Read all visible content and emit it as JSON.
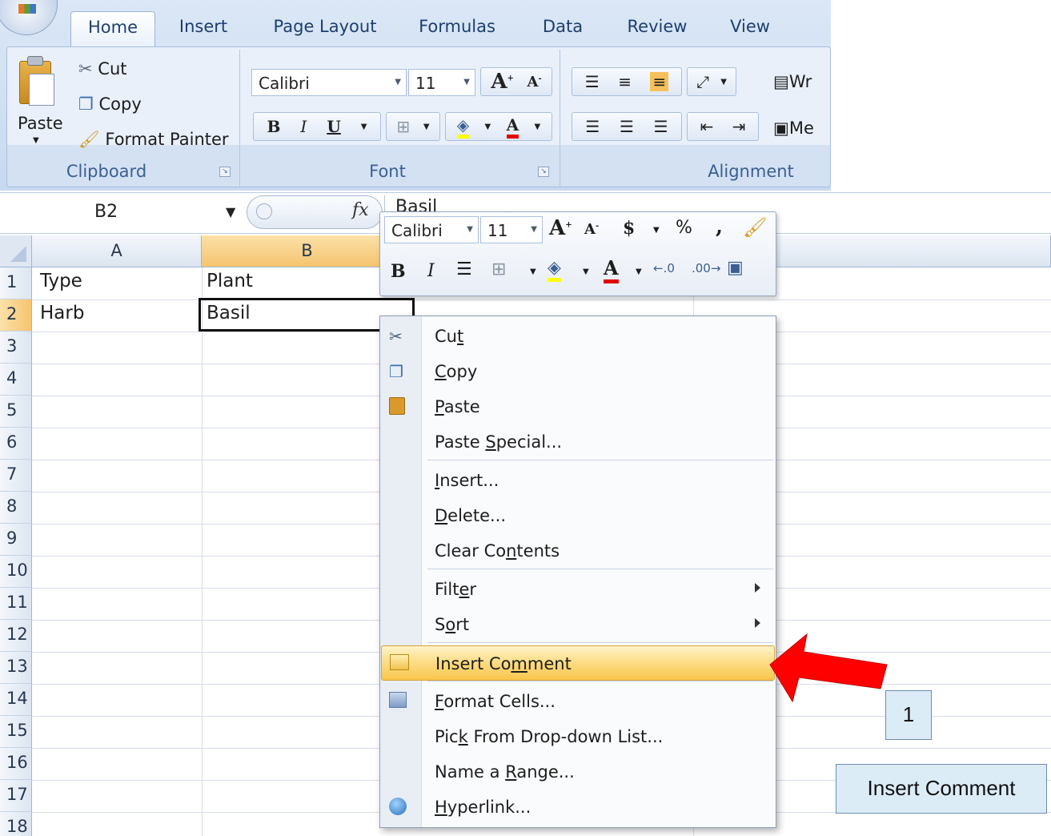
{
  "ribbon": {
    "tabs": [
      "Home",
      "Insert",
      "Page Layout",
      "Formulas",
      "Data",
      "Review",
      "View"
    ],
    "active_tab": "Home",
    "clipboard": {
      "group_label": "Clipboard",
      "paste": "Paste",
      "cut": "Cut",
      "copy": "Copy",
      "format_painter": "Format Painter"
    },
    "font": {
      "group_label": "Font",
      "font_name": "Calibri",
      "font_size": "11",
      "bold": "B",
      "italic": "I",
      "underline": "U"
    },
    "alignment": {
      "group_label": "Alignment",
      "wrap_text_partial": "Wr",
      "merge_partial": "Me"
    }
  },
  "formula_bar": {
    "name_box": "B2",
    "fx": "fx",
    "value": "Basil"
  },
  "grid": {
    "columns": [
      "A",
      "B"
    ],
    "selected_column": "B",
    "rows": [
      "1",
      "2",
      "3",
      "4",
      "5",
      "6",
      "7",
      "8",
      "9",
      "10",
      "11",
      "12",
      "13",
      "14",
      "15",
      "16",
      "17",
      "18"
    ],
    "selected_row": "2",
    "cells": {
      "A1": "Type",
      "B1": "Plant",
      "A2": "Harb",
      "B2": "Basil"
    }
  },
  "mini_toolbar": {
    "font_name": "Calibri",
    "font_size": "11",
    "currency": "$",
    "percent": "%",
    "comma": ",",
    "bold": "B",
    "italic": "I"
  },
  "context_menu": {
    "items": [
      {
        "pre": "Cu",
        "key": "t",
        "post": "",
        "icon": "scissors-icon"
      },
      {
        "pre": "",
        "key": "C",
        "post": "opy",
        "icon": "copy-icon"
      },
      {
        "pre": "",
        "key": "P",
        "post": "aste",
        "icon": "paste-icon"
      },
      {
        "pre": "Paste ",
        "key": "S",
        "post": "pecial...",
        "icon": ""
      },
      {
        "pre": "",
        "key": "I",
        "post": "nsert...",
        "icon": ""
      },
      {
        "pre": "",
        "key": "D",
        "post": "elete...",
        "icon": ""
      },
      {
        "pre": "Clear Co",
        "key": "n",
        "post": "tents",
        "icon": ""
      },
      {
        "pre": "Filt",
        "key": "e",
        "post": "r",
        "icon": ""
      },
      {
        "pre": "S",
        "key": "o",
        "post": "rt",
        "icon": ""
      },
      {
        "pre": "Insert Co",
        "key": "m",
        "post": "ment",
        "icon": "comment-icon"
      },
      {
        "pre": "",
        "key": "F",
        "post": "ormat Cells...",
        "icon": "format-cells-icon"
      },
      {
        "pre": "Pic",
        "key": "k",
        "post": " From Drop-down List...",
        "icon": ""
      },
      {
        "pre": "Name a ",
        "key": "R",
        "post": "ange...",
        "icon": ""
      },
      {
        "pre": "",
        "key": "H",
        "post": "yperlink...",
        "icon": "hyperlink-icon"
      }
    ],
    "highlighted": "Insert Comment"
  },
  "annotation": {
    "step_number": "1",
    "caption": "Insert Comment",
    "arrow_color": "#ff0000"
  }
}
